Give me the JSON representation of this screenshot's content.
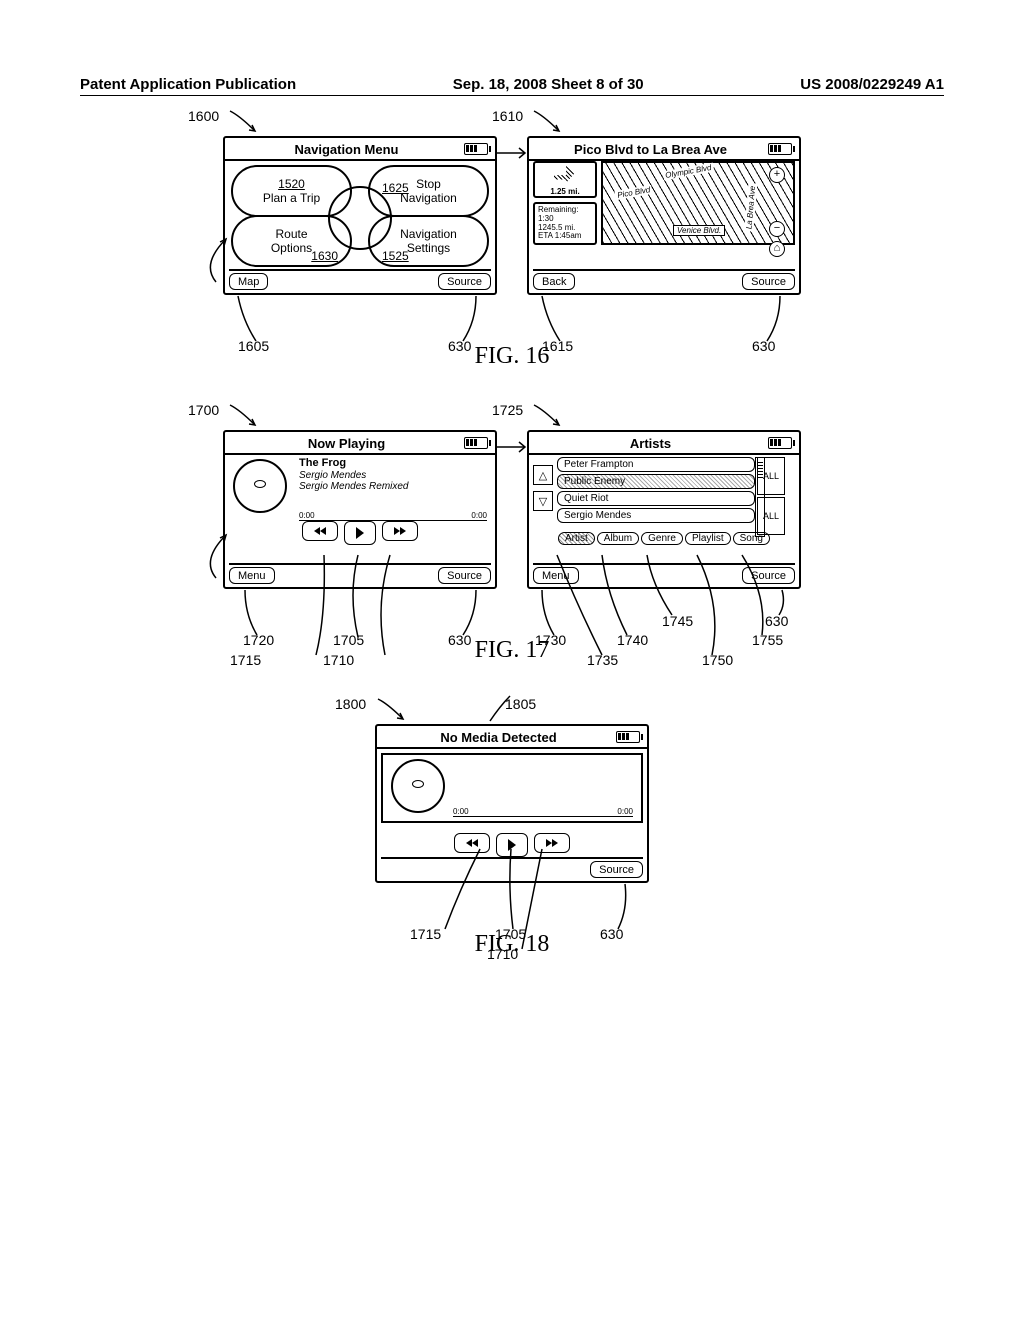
{
  "header": {
    "left": "Patent Application Publication",
    "mid": "Sep. 18, 2008  Sheet 8 of 30",
    "right": "US 2008/0229249 A1"
  },
  "fig16": {
    "label": "FIG. 16",
    "left": {
      "ref": "1600",
      "title": "Navigation Menu",
      "tl_label": "Plan a Trip",
      "tl_ref": "1520",
      "tr_label1": "Stop",
      "tr_label2": "Navigation",
      "tr_ref": "1625",
      "bl_label1": "Route",
      "bl_label2": "Options",
      "bl_ref": "1630",
      "br_label1": "Navigation",
      "br_label2": "Settings",
      "br_ref": "1525",
      "softleft": "Map",
      "softleft_ref": "1605",
      "softright": "Source",
      "softright_ref": "630"
    },
    "right": {
      "ref": "1610",
      "title": "Pico Blvd to La Brea Ave",
      "dist": "1.25 mi.",
      "stat1": "Remaining:",
      "stat2": "1:30",
      "stat3": "1245.5 mi.",
      "stat4": "ETA 1:45am",
      "road1": "Olympic Blvd",
      "road2": "Pico Blvd",
      "road3": "Venice Blvd.",
      "road4": "La Brea Ave",
      "plus": "+",
      "minus": "−",
      "softleft": "Back",
      "softleft_ref": "1615",
      "softright": "Source",
      "softright_ref": "630"
    }
  },
  "fig17": {
    "label": "FIG. 17",
    "left": {
      "ref": "1700",
      "title": "Now Playing",
      "song": "The Frog",
      "artist": "Sergio Mendes",
      "album": "Sergio Mendes Remixed",
      "t0": "0:00",
      "t1": "0:00",
      "softleft": "Menu",
      "softright": "Source",
      "refs": {
        "softleft": "1720",
        "play": "1705",
        "fwd": "1710",
        "rew": "1715",
        "source": "630"
      }
    },
    "right": {
      "ref": "1725",
      "title": "Artists",
      "items": [
        "Peter Frampton",
        "Public Enemy",
        "Quiet Riot",
        "Sergio Mendes"
      ],
      "all": "ALL",
      "up": "△",
      "down": "▽",
      "tabs": [
        "Artist",
        "Album",
        "Genre",
        "Playlist",
        "Song"
      ],
      "softleft": "Menu",
      "softright": "Source",
      "refs": {
        "softleft": "1730",
        "artist": "1735",
        "album": "1740",
        "genre": "1745",
        "playlist": "1750",
        "song": "1755",
        "source": "630"
      }
    }
  },
  "fig18": {
    "label": "FIG. 18",
    "ref": "1800",
    "title_ref": "1805",
    "title": "No Media Detected",
    "t0": "0:00",
    "t1": "0:00",
    "softright": "Source",
    "refs": {
      "rew": "1715",
      "play": "1705",
      "fwd": "1710",
      "source": "630"
    }
  }
}
